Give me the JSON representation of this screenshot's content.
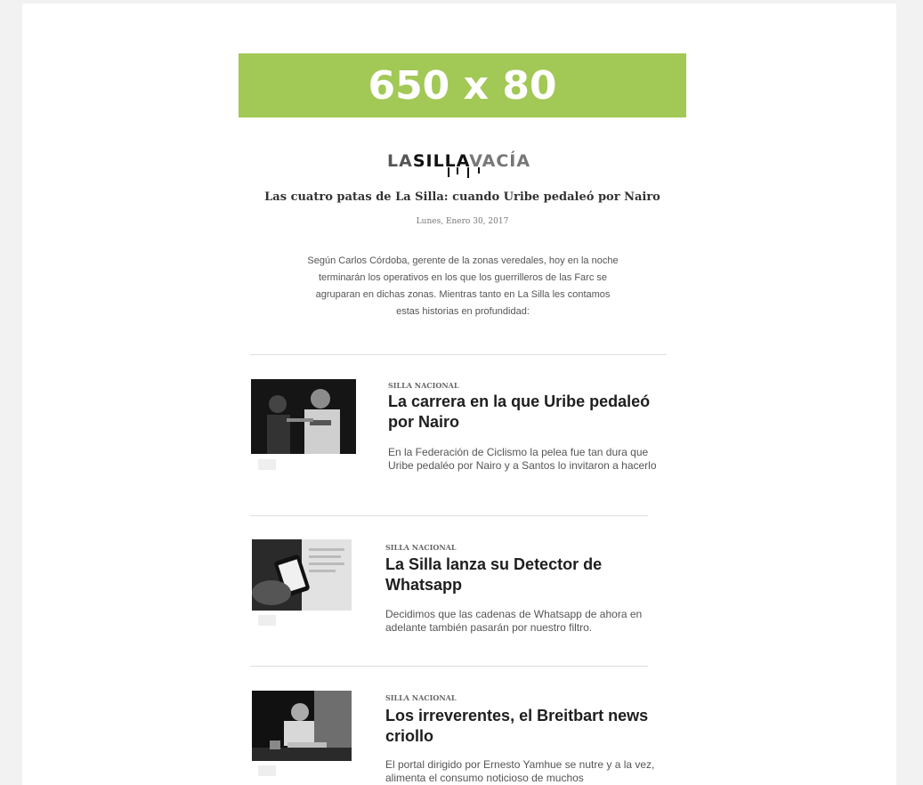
{
  "banner": {
    "text": "650 x 80",
    "color": "#a2c856"
  },
  "logo": {
    "part_a": "LA",
    "part_b": "SILLA",
    "part_c": "VACÍA"
  },
  "newsletter": {
    "headline": "Las cuatro patas de La Silla: cuando Uribe pedaleó por Nairo",
    "date": "Lunes, Enero 30, 2017",
    "intro": "Según Carlos Córdoba, gerente de la zonas veredales, hoy en la noche terminarán los operativos en los que los guerrilleros de las Farc se agruparan en dichas zonas. Mientras tanto en La Silla les contamos estas historias en profundidad:"
  },
  "articles": [
    {
      "category": "SILLA NACIONAL",
      "title": "La carrera en la que Uribe pedaleó por Nairo",
      "description": "En la Federación de Ciclismo la pelea fue tan dura que Uribe pedaléo por Nairo y a Santos lo invitaron a hacerlo",
      "image_icon": "cyclist-photo"
    },
    {
      "category": "SILLA NACIONAL",
      "title": "La Silla lanza su Detector de Whatsapp",
      "description": "Decidimos que las cadenas de Whatsapp de ahora en adelante también pasarán por nuestro filtro.",
      "image_icon": "phone-photo"
    },
    {
      "category": "SILLA NACIONAL",
      "title": "Los irreverentes, el Breitbart news criollo",
      "description": "El portal dirigido por Ernesto Yamhue se nutre y a la vez, alimenta el consumo noticioso de muchos",
      "image_icon": "man-reading-photo"
    }
  ]
}
